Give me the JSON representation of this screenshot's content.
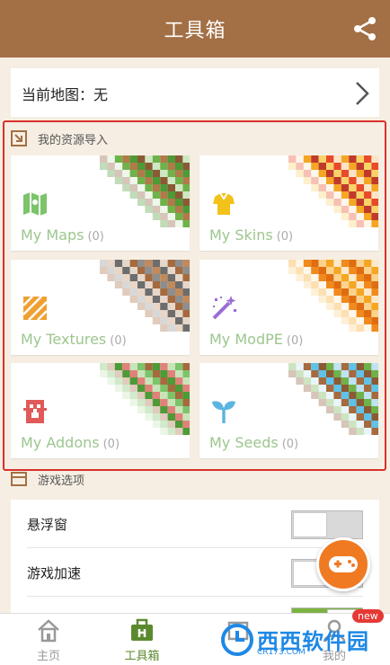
{
  "header": {
    "title": "工具箱",
    "share_icon": "share-icon"
  },
  "current_map": {
    "label": "当前地图：无"
  },
  "resources": {
    "title": "我的资源导入",
    "cards": [
      {
        "name": "My Maps",
        "count": "(0)",
        "icon": "map-icon",
        "icon_color": "#7cc36a"
      },
      {
        "name": "My Skins",
        "count": "(0)",
        "icon": "shirt-icon",
        "icon_color": "#f2c21b"
      },
      {
        "name": "My Textures",
        "count": "(0)",
        "icon": "texture-icon",
        "icon_color": "#f0a030"
      },
      {
        "name": "My ModPE",
        "count": "(0)",
        "icon": "magic-wand-icon",
        "icon_color": "#9b6cd6"
      },
      {
        "name": "My Addons",
        "count": "(0)",
        "icon": "creeper-icon",
        "icon_color": "#e05a5a"
      },
      {
        "name": "My Seeds",
        "count": "(0)",
        "icon": "sprout-icon",
        "icon_color": "#5bb5e0"
      }
    ]
  },
  "game_options": {
    "title": "游戏选项",
    "rows": [
      {
        "label": "悬浮窗",
        "on": false
      },
      {
        "label": "游戏加速",
        "on": false
      },
      {
        "label": "",
        "on": true
      }
    ]
  },
  "tabbar": {
    "tabs": [
      {
        "label": "主页",
        "icon": "home-icon",
        "active": false
      },
      {
        "label": "工具箱",
        "icon": "toolbox-icon",
        "active": true
      },
      {
        "label": "",
        "icon": "store-icon",
        "active": false
      },
      {
        "label": "我的",
        "icon": "profile-icon",
        "active": false
      }
    ],
    "badge": "new"
  },
  "watermark": {
    "text": "西西软件园",
    "sub": "CR173.COM"
  },
  "colors": {
    "header": "#a36f45",
    "accent_green": "#9cc68e",
    "highlight_red": "#d9312b",
    "fab": "#f07a22"
  }
}
